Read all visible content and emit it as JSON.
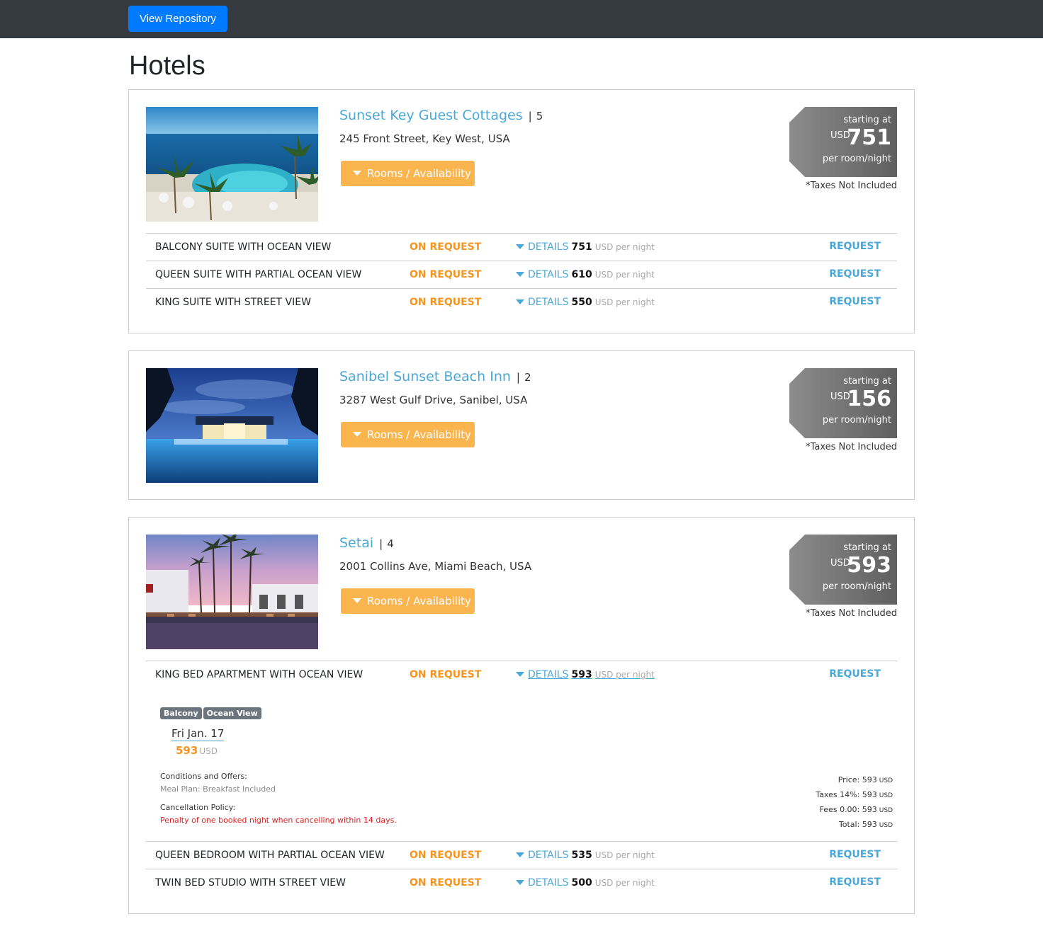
{
  "navbar": {
    "repo_button": "View Repository"
  },
  "page_title": "Hotels",
  "common": {
    "availability_label": "Rooms / Availability",
    "starting_at": "starting at",
    "currency": "USD",
    "per_room": "per room/night",
    "taxes_note": "*Taxes Not Included",
    "on_request": "ON REQUEST",
    "details": "DETAILS",
    "usd_per_night": "USD per night",
    "request": "REQUEST",
    "separator": "|"
  },
  "hotels": [
    {
      "name": "Sunset Key Guest Cottages",
      "stars": "5",
      "address": "245 Front Street, Key West, USA",
      "price": "751",
      "rooms": [
        {
          "name": "BALCONY SUITE WITH OCEAN VIEW",
          "price": "751"
        },
        {
          "name": "QUEEN SUITE WITH PARTIAL OCEAN VIEW",
          "price": "610"
        },
        {
          "name": "KING SUITE WITH STREET VIEW",
          "price": "550"
        }
      ]
    },
    {
      "name": "Sanibel Sunset Beach Inn",
      "stars": "2",
      "address": "3287 West Gulf Drive, Sanibel, USA",
      "price": "156",
      "rooms": []
    },
    {
      "name": "Setai",
      "stars": "4",
      "address": "2001 Collins Ave, Miami Beach, USA",
      "price": "593",
      "rooms": [
        {
          "name": "KING BED APARTMENT WITH OCEAN VIEW",
          "price": "593"
        },
        {
          "name": "QUEEN BEDROOM WITH PARTIAL OCEAN VIEW",
          "price": "535"
        },
        {
          "name": "TWIN BED STUDIO WITH STREET VIEW",
          "price": "500"
        }
      ],
      "expanded": {
        "badges": [
          "Balcony",
          "Ocean View"
        ],
        "date": "Fri Jan. 17",
        "date_price": "593",
        "date_currency": "USD",
        "conditions_label": "Conditions and Offers:",
        "meal_plan": "Meal Plan: Breakfast Included",
        "cancellation_label": "Cancellation Policy:",
        "penalty": "Penalty of one booked night when cancelling within 14 days.",
        "price_line": "Price: 593",
        "taxes_line": "Taxes 14%: 593",
        "fees_line": "Fees 0.00: 593",
        "total_line": "Total: 593",
        "line_currency": "USD"
      }
    }
  ]
}
